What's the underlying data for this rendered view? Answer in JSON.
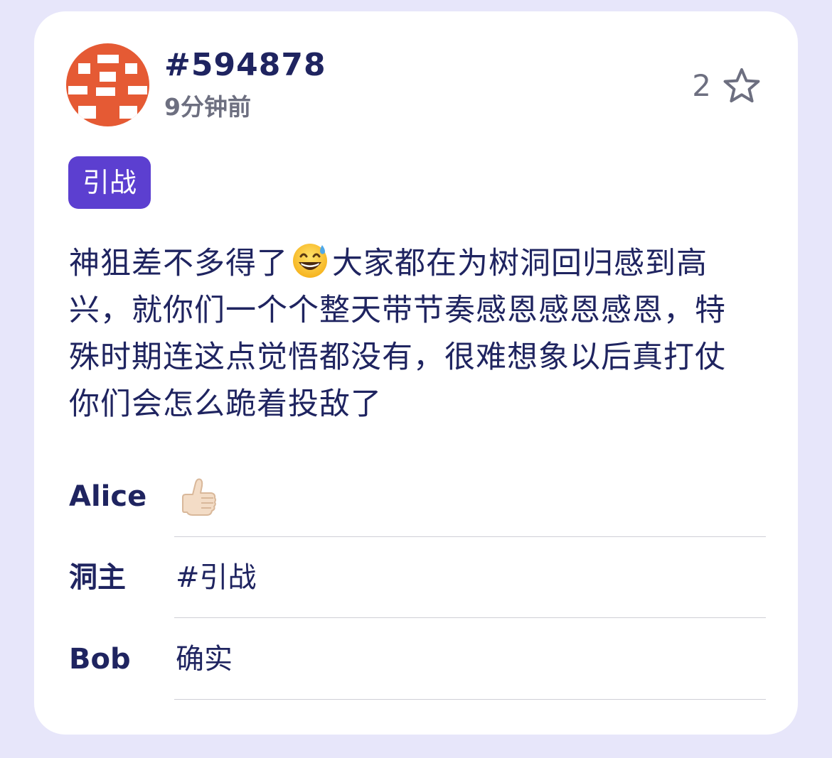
{
  "post": {
    "id": "#594878",
    "time": "9分钟前",
    "star_count": "2",
    "tag": "引战",
    "content_part1": "神狙差不多得了",
    "emoji": "grinning-face-with-sweat-icon",
    "content_part2": "大家都在为树洞回归感到高兴，就你们一个个整天带节奏感恩感恩感恩，特殊时期连这点觉悟都没有，很难想象以后真打仗你们会怎么跪着投敌了"
  },
  "replies": [
    {
      "name": "Alice",
      "text": "",
      "icon": "thumbs-up-icon"
    },
    {
      "name": "洞主",
      "text": "#引战"
    },
    {
      "name": "Bob",
      "text": "确实"
    }
  ],
  "colors": {
    "background": "#e7e6fa",
    "card": "#ffffff",
    "text": "#1f2460",
    "muted": "#6d6f80",
    "tag": "#5c3fd0",
    "avatar": "#e55a34"
  }
}
